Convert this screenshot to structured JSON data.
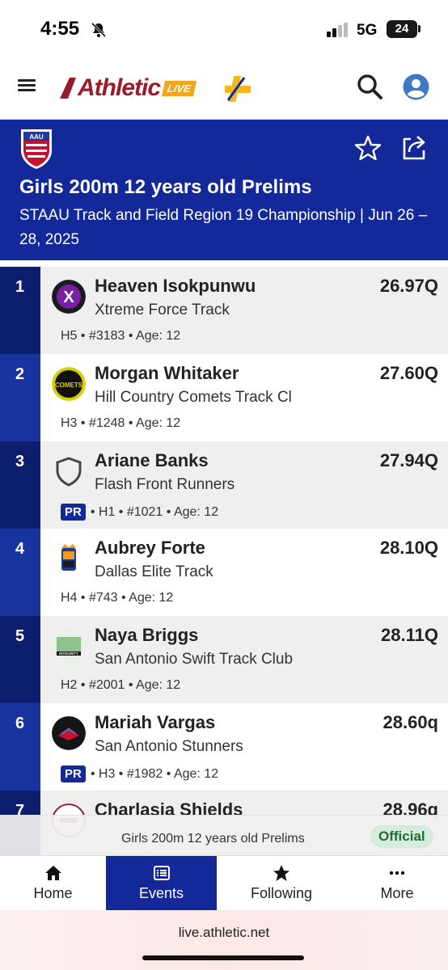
{
  "status_bar": {
    "time": "4:55",
    "network": "5G",
    "battery": "24"
  },
  "header": {
    "brand": "Athletic",
    "brand_badge": "LIVE"
  },
  "event": {
    "title": "Girls 200m 12 years old Prelims",
    "subtitle": "STAAU Track and Field Region 19 Championship | Jun 26 – 28, 2025",
    "org_logo_text": "AAU"
  },
  "results": [
    {
      "rank": "1",
      "name": "Heaven Isokpunwu",
      "mark": "26.97Q",
      "team": "Xtreme Force Track",
      "pr": "",
      "meta": "H5 • #3183 • Age: 12",
      "logo_text": "X"
    },
    {
      "rank": "2",
      "name": "Morgan Whitaker",
      "mark": "27.60Q",
      "team": "Hill Country Comets Track Cl",
      "pr": "",
      "meta": "H3 • #1248 • Age: 12",
      "logo_text": "COMETS"
    },
    {
      "rank": "3",
      "name": "Ariane Banks",
      "mark": "27.94Q",
      "team": "Flash Front Runners",
      "pr": "PR",
      "meta": "• H1 • #1021 • Age: 12",
      "logo_text": ""
    },
    {
      "rank": "4",
      "name": "Aubrey Forte",
      "mark": "28.10Q",
      "team": "Dallas Elite Track",
      "pr": "",
      "meta": "H4 • #743 • Age: 12",
      "logo_text": ""
    },
    {
      "rank": "5",
      "name": "Naya Briggs",
      "mark": "28.11Q",
      "team": "San Antonio Swift Track Club",
      "pr": "",
      "meta": "H2 • #2001 • Age: 12",
      "logo_text": "INTEGRITY"
    },
    {
      "rank": "6",
      "name": "Mariah Vargas",
      "mark": "28.60q",
      "team": "San Antonio Stunners",
      "pr": "PR",
      "meta": "• H3 • #1982 • Age: 12",
      "logo_text": ""
    },
    {
      "rank": "7",
      "name": "Charlasia Shields",
      "mark": "28.96q",
      "team": "",
      "pr": "",
      "meta": "",
      "logo_text": ""
    }
  ],
  "status_strip": {
    "label": "Girls 200m 12 years old Prelims",
    "badge": "Official"
  },
  "nav": {
    "home": "Home",
    "events": "Events",
    "following": "Following",
    "more": "More"
  },
  "browser": {
    "url": "live.athletic.net"
  },
  "colors": {
    "primary": "#13299a",
    "rank_dark": "#0d1e6e",
    "brand_red": "#9a1b2a",
    "official_green": "#1f6b3a"
  }
}
